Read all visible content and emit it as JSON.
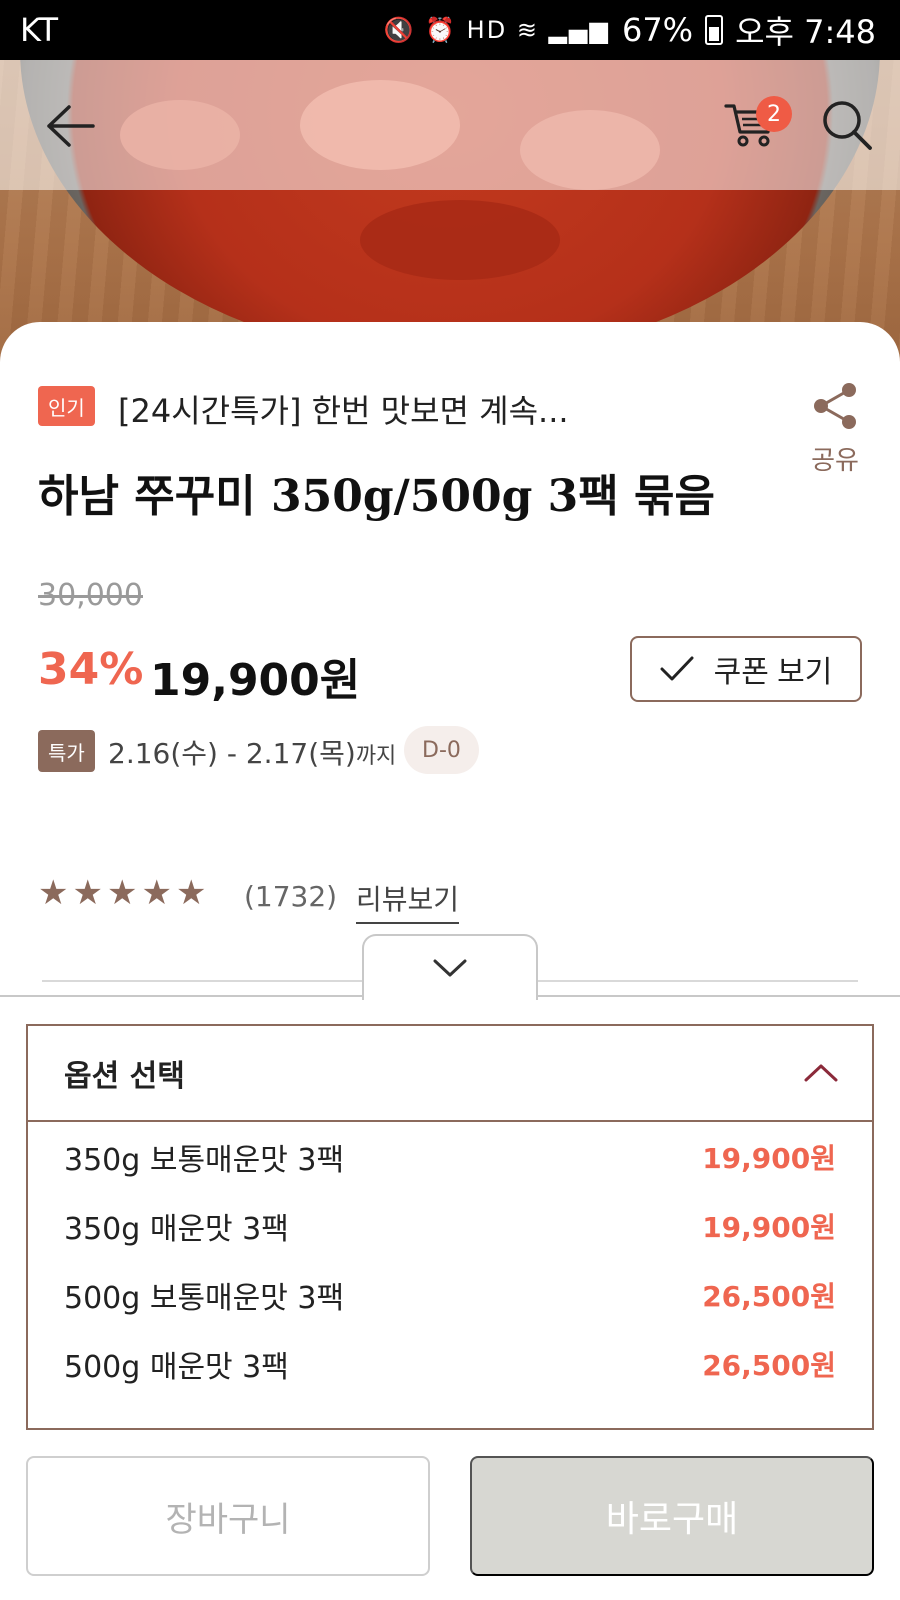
{
  "status_bar": {
    "carrier": "KT",
    "battery": "67%",
    "time": "오후 7:48"
  },
  "header": {
    "cart_count": "2",
    "carousel_pages": 4,
    "carousel_active_index": 0
  },
  "product": {
    "badge": "인기",
    "promo_text": "[24시간특가] 한번 맛보면 계속...",
    "share_label": "공유",
    "title": "하남 쭈꾸미 350g/500g 3팩 묶음",
    "original_price": "30,000",
    "discount": "34%",
    "sale_price": "19,900원",
    "coupon_label": "쿠폰 보기",
    "special_tag": "특가",
    "special_period": "2.16(수) - 2.17(목)",
    "special_period_suffix": "까지",
    "dday": "D-0",
    "rating_stars": 5,
    "review_count": "(1732)",
    "review_link": "리뷰보기"
  },
  "options": {
    "title": "옵션 선택",
    "items": [
      {
        "name": "350g 보통매운맛 3팩",
        "price": "19,900원"
      },
      {
        "name": "350g 매운맛 3팩",
        "price": "19,900원"
      },
      {
        "name": "500g 보통매운맛 3팩",
        "price": "26,500원"
      },
      {
        "name": "500g 매운맛 3팩",
        "price": "26,500원"
      }
    ]
  },
  "actions": {
    "cart_button": "장바구니",
    "buy_button": "바로구매"
  },
  "colors": {
    "accent": "#ef6650",
    "brown": "#8b6a5c",
    "disabled_bg": "#d7d7d2"
  }
}
